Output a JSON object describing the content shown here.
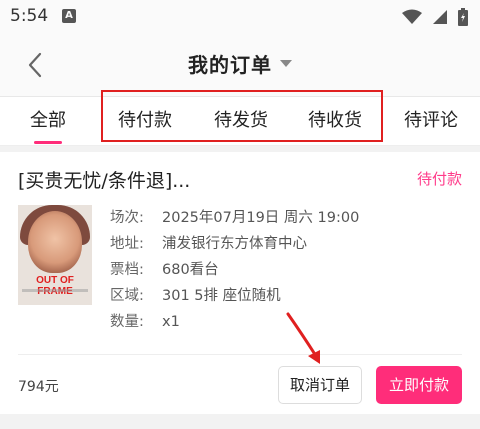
{
  "status_bar": {
    "time": "5:54",
    "notification_letter": "A",
    "icons": [
      "wifi-icon",
      "signal-icon",
      "battery-icon"
    ]
  },
  "nav": {
    "title": "我的订单",
    "back_icon": "chevron-left-icon",
    "dropdown_icon": "caret-down-icon"
  },
  "tabs": [
    {
      "label": "全部",
      "active": true
    },
    {
      "label": "待付款",
      "active": false
    },
    {
      "label": "待发货",
      "active": false
    },
    {
      "label": "待收货",
      "active": false
    },
    {
      "label": "待评论",
      "active": false
    }
  ],
  "order": {
    "title": "[买贵无忧/条件退]...",
    "status": "待付款",
    "poster_text": "OUT OF FRAME",
    "details": [
      {
        "key": "场次:",
        "value": "2025年07月19日 周六 19:00"
      },
      {
        "key": "地址:",
        "value": "浦发银行东方体育中心"
      },
      {
        "key": "票档:",
        "value": "680看台"
      },
      {
        "key": "区域:",
        "value": "301 5排 座位随机"
      },
      {
        "key": "数量:",
        "value": "x1"
      }
    ],
    "price": "794元",
    "cancel_label": "取消订单",
    "pay_label": "立即付款"
  },
  "colors": {
    "accent": "#ff2d7a",
    "status_pink": "#ff3b8a",
    "annotation_red": "#e02020"
  }
}
